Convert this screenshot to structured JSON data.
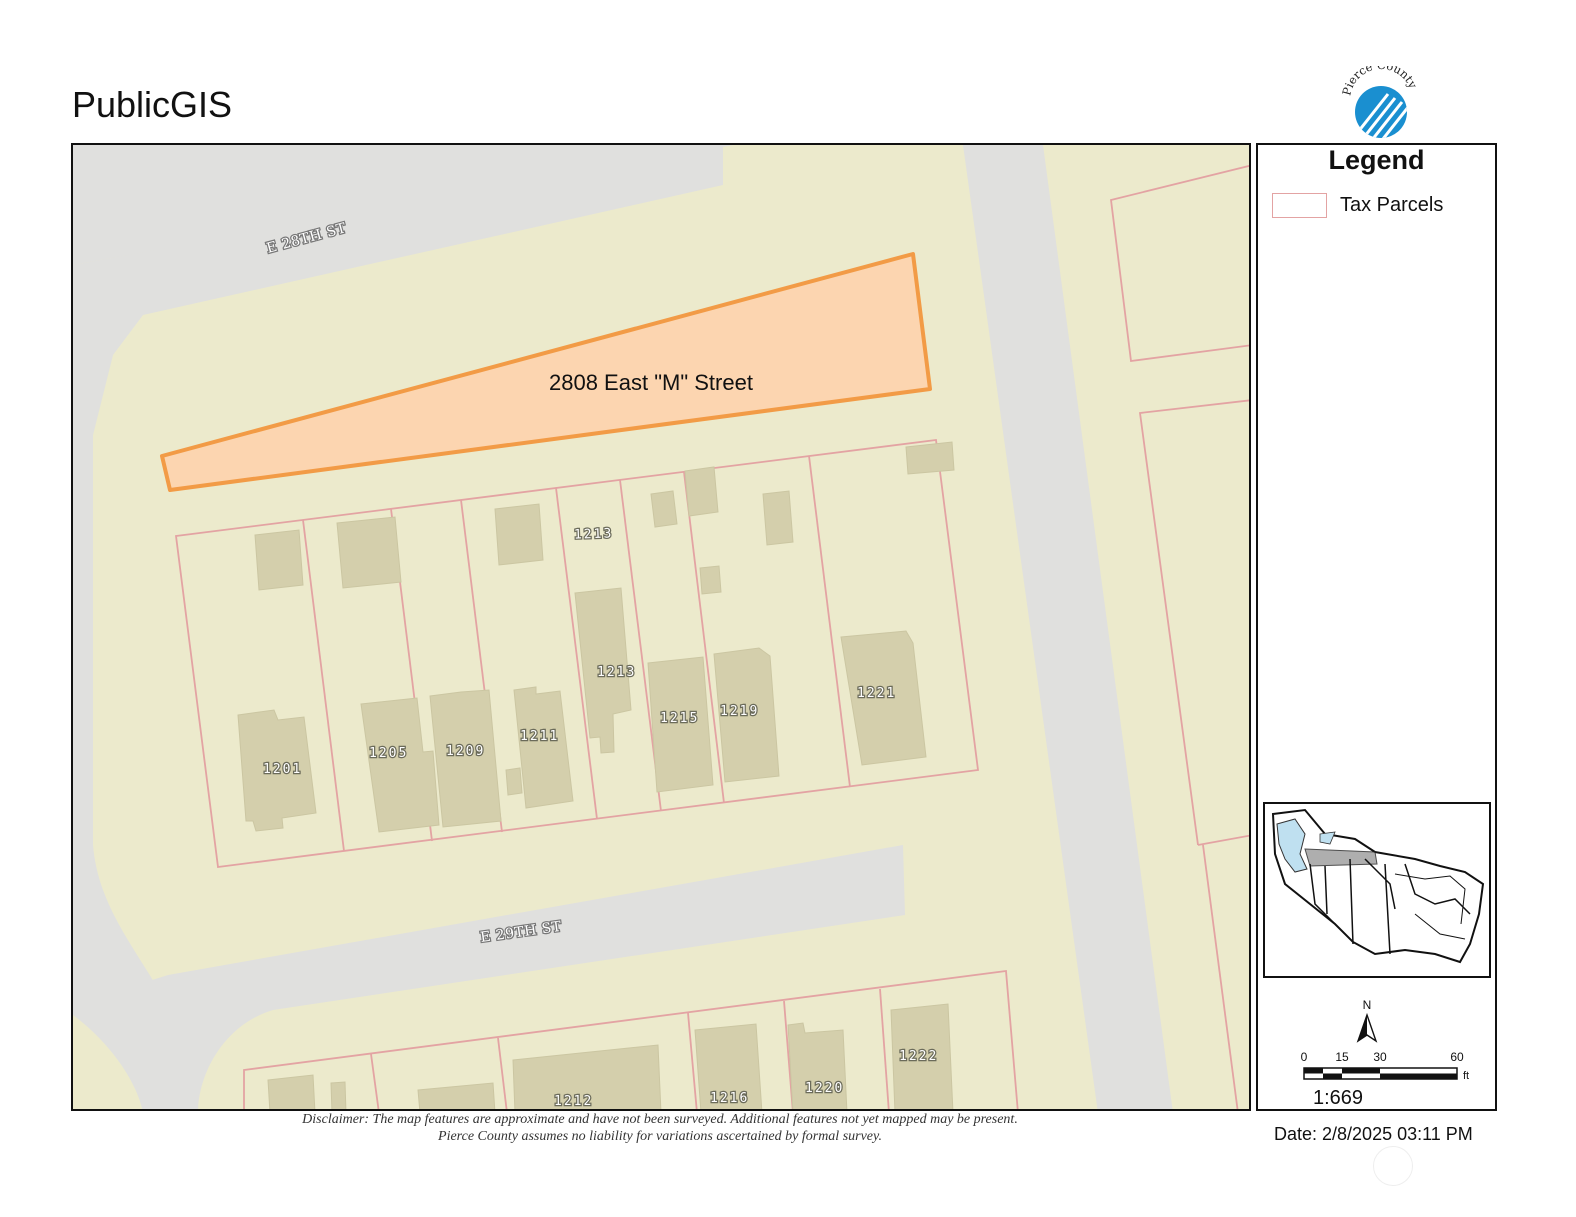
{
  "header": {
    "title": "PublicGIS"
  },
  "logo": {
    "text": "Pierce County",
    "colors": {
      "blue": "#1a8fd0",
      "light": "#bfe3f6"
    }
  },
  "map": {
    "colors": {
      "land": "#eceacc",
      "road": "#e0e0de",
      "parcel_outline": "#e3a3a3",
      "building": "#d4cfac",
      "selected_fill": "#fcd5b0",
      "selected_outline": "#f29b46"
    },
    "streets": {
      "north": "E 28TH ST",
      "south": "E 29TH ST"
    },
    "selected_parcel_label": "2808 East \"M\" Street",
    "lot_numbers": {
      "n1201": "1201",
      "n1205": "1205",
      "n1209": "1209",
      "n1211": "1211",
      "n1213_top": "1213",
      "n1213_mid": "1213",
      "n1215": "1215",
      "n1219": "1219",
      "n1221": "1221",
      "n1212": "1212",
      "n1216": "1216",
      "n1220": "1220",
      "n1222": "1222"
    }
  },
  "legend": {
    "title": "Legend",
    "items": [
      {
        "label": "Tax Parcels",
        "swatch": "outline"
      }
    ],
    "north_label": "N",
    "scale_ticks": {
      "t0": "0",
      "t15": "15",
      "t30": "30",
      "t60": "60"
    },
    "scale_unit": "ft",
    "scale_ratio": "1:669"
  },
  "footer": {
    "disclaimer_line1": "Disclaimer: The map features are approximate and have not been surveyed. Additional features not yet mapped may be present.",
    "disclaimer_line2": "Pierce County assumes no liability for variations ascertained by formal survey.",
    "date": "Date: 2/8/2025  03:11 PM"
  }
}
